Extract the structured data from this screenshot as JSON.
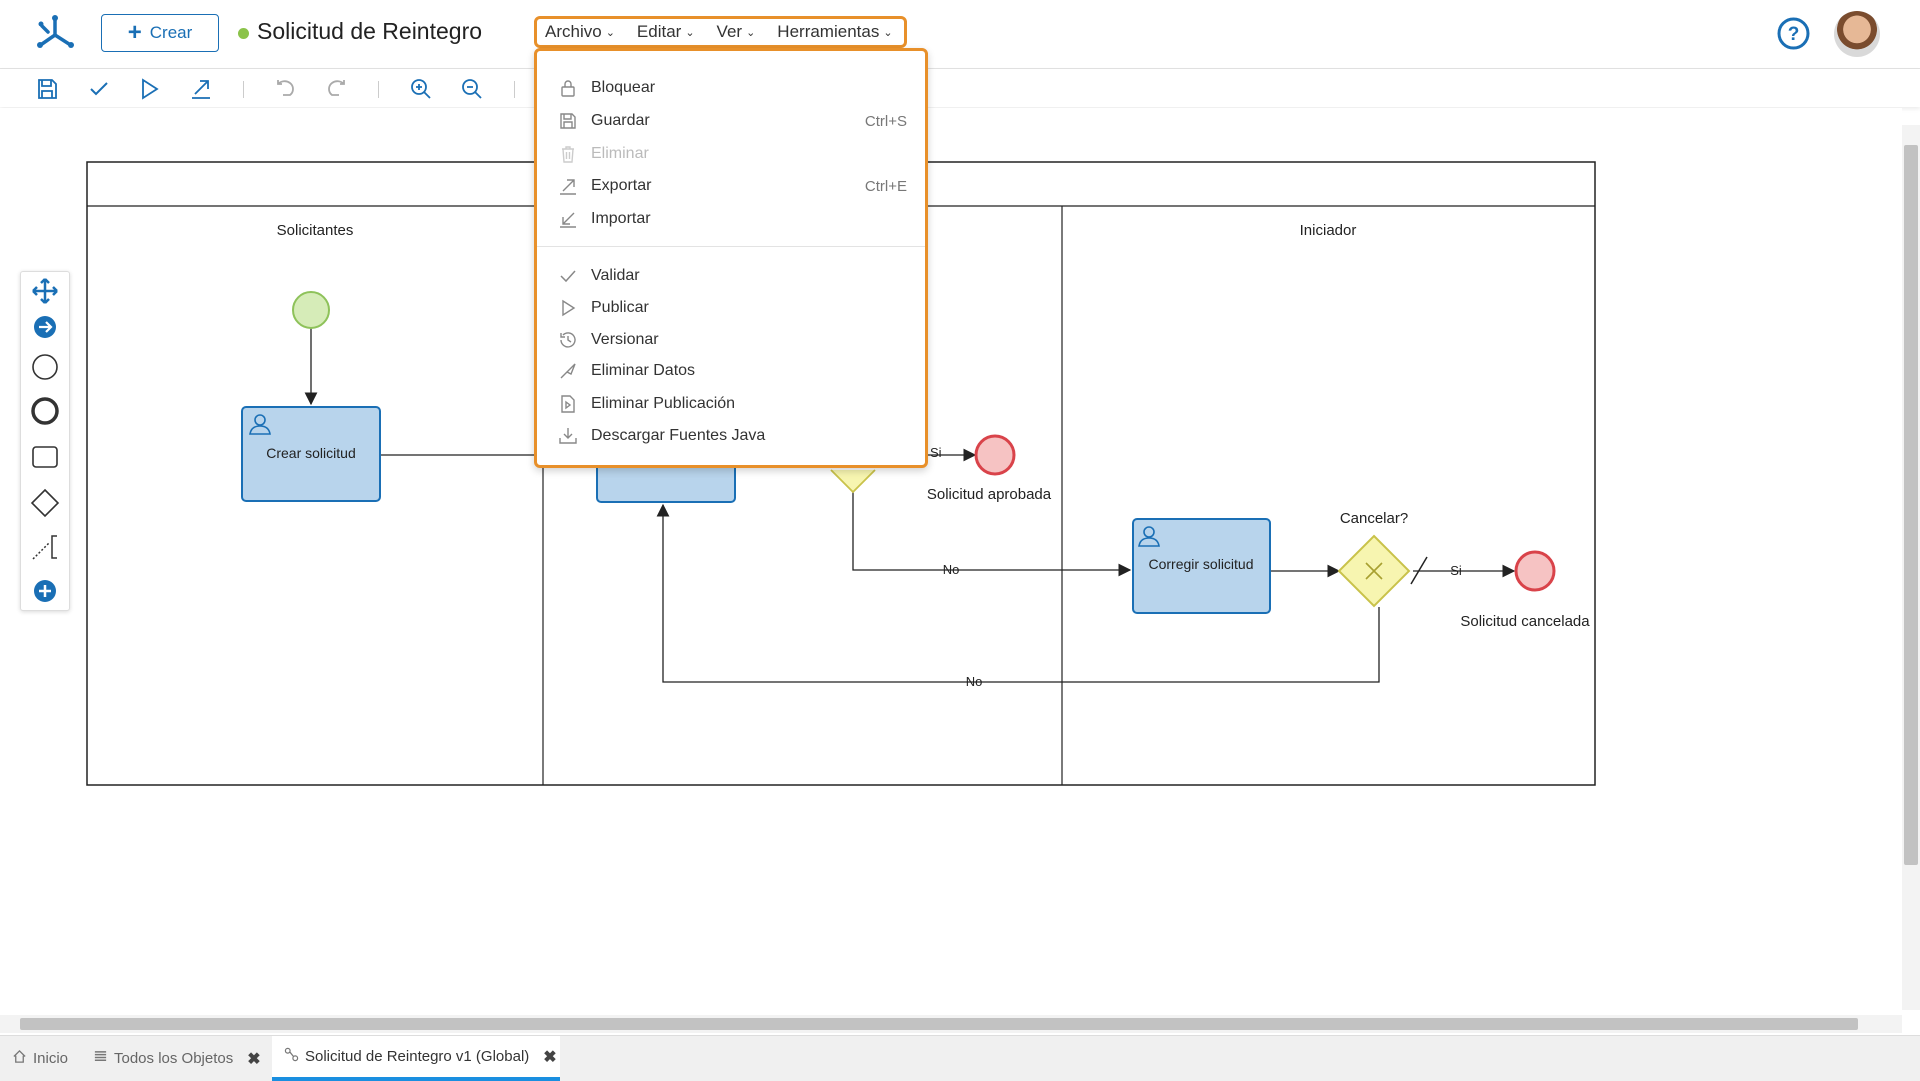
{
  "header": {
    "create_label": "Crear",
    "doc_title": "Solicitud de Reintegro",
    "menus": [
      "Archivo",
      "Editar",
      "Ver",
      "Herramientas"
    ]
  },
  "colors": {
    "accent": "#1a6fb5",
    "highlight": "#e8902a",
    "status": "#8bc34a",
    "task_fill": "#b8d4ec",
    "task_border": "#1a6fb5",
    "gateway_fill": "#f7f5b0",
    "start_fill": "#d6ecb8",
    "end_fill": "#f6c3c3"
  },
  "file_menu": {
    "items": [
      {
        "label": "Bloquear",
        "icon": "lock-icon",
        "shortcut": "",
        "disabled": false
      },
      {
        "label": "Guardar",
        "icon": "save-icon",
        "shortcut": "Ctrl+S",
        "disabled": false
      },
      {
        "label": "Eliminar",
        "icon": "trash-icon",
        "shortcut": "",
        "disabled": true
      },
      {
        "label": "Exportar",
        "icon": "export-icon",
        "shortcut": "Ctrl+E",
        "disabled": false
      },
      {
        "label": "Importar",
        "icon": "import-icon",
        "shortcut": "",
        "disabled": false
      },
      {
        "label": "Validar",
        "icon": "check-icon",
        "shortcut": "",
        "disabled": false
      },
      {
        "label": "Publicar",
        "icon": "play-icon",
        "shortcut": "",
        "disabled": false
      },
      {
        "label": "Versionar",
        "icon": "history-icon",
        "shortcut": "",
        "disabled": false
      },
      {
        "label": "Eliminar Datos",
        "icon": "eraser-icon",
        "shortcut": "",
        "disabled": false
      },
      {
        "label": "Eliminar Publicación",
        "icon": "unpublish-icon",
        "shortcut": "",
        "disabled": false
      },
      {
        "label": "Descargar Fuentes Java",
        "icon": "download-icon",
        "shortcut": "",
        "disabled": false
      }
    ]
  },
  "diagram": {
    "lanes": [
      "Solicitantes",
      "Iniciador"
    ],
    "tasks": [
      "Crear solicitud",
      "Corregir solicitud"
    ],
    "gateway_label": "Cancelar?",
    "end_events": [
      "Solicitud aprobada",
      "Solicitud cancelada"
    ],
    "flow_labels": [
      "No",
      "No",
      "Si",
      "Si"
    ]
  },
  "bottom_tabs": [
    {
      "label": "Inicio",
      "icon": "home-icon",
      "closable": false
    },
    {
      "label": "Todos los Objetos",
      "icon": "list-icon",
      "closable": true
    },
    {
      "label": "Solicitud de Reintegro v1 (Global)",
      "icon": "process-icon",
      "closable": true
    }
  ]
}
